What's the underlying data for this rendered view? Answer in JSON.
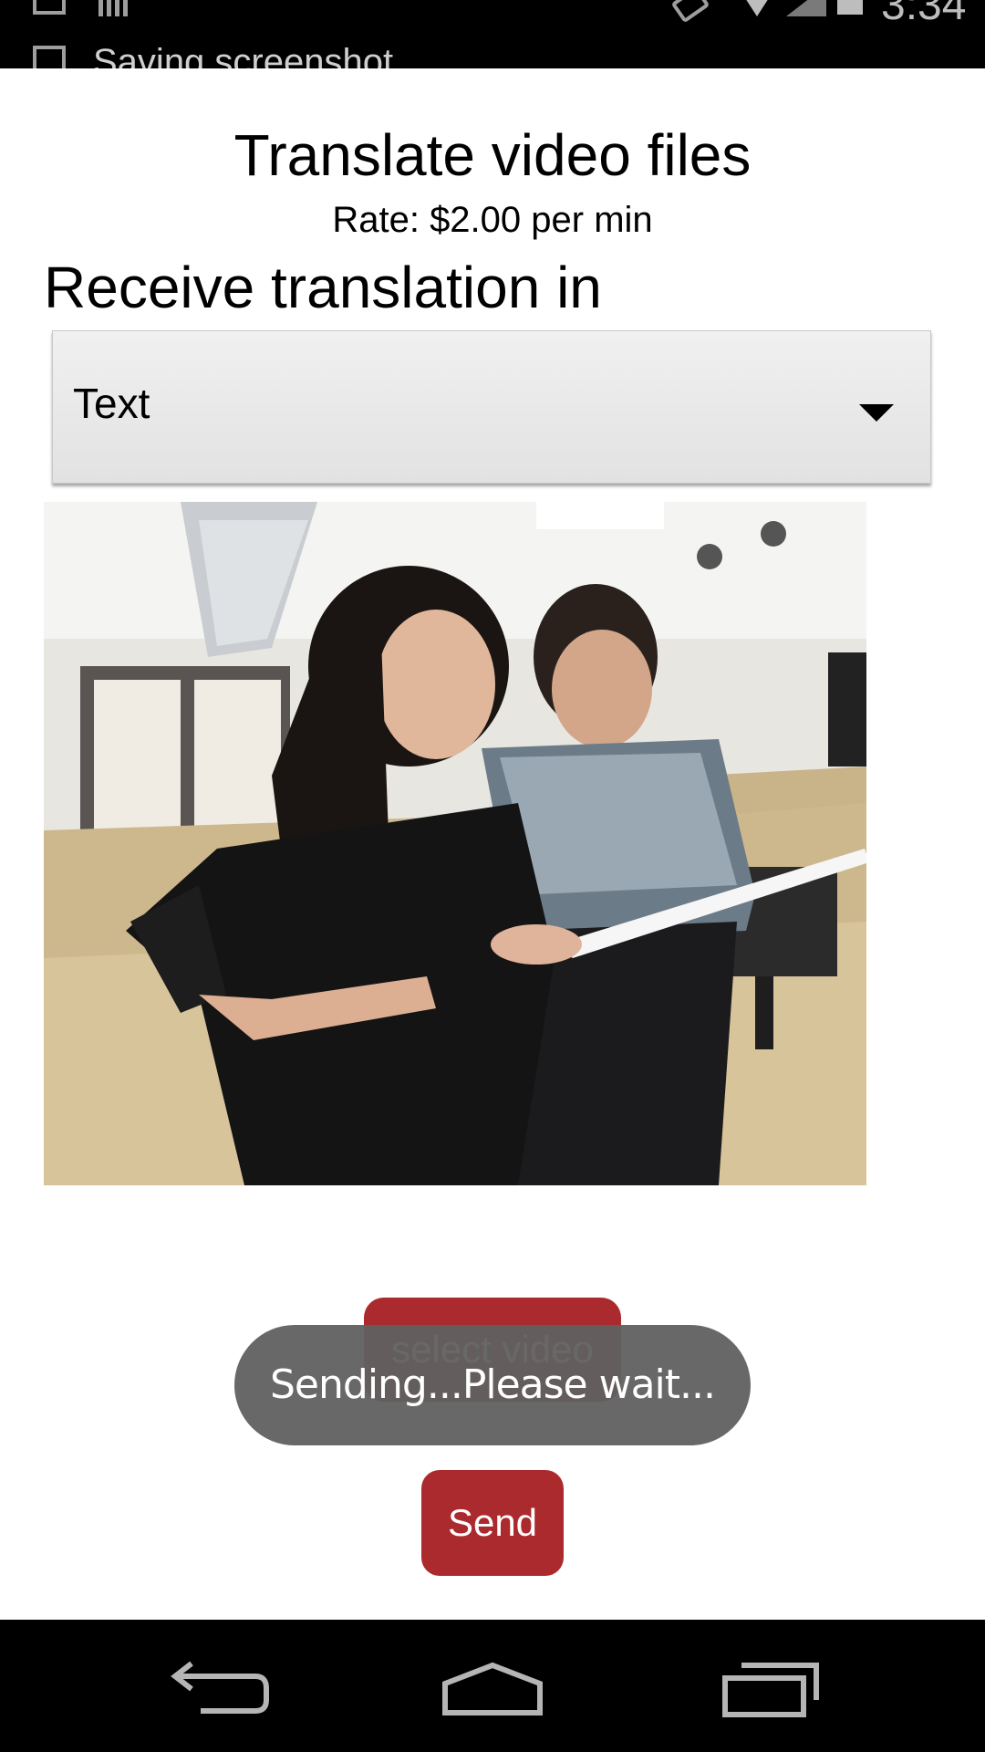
{
  "status_bar": {
    "notification_text": "Saving screenshot",
    "time": "3:34",
    "icons": [
      "gallery-icon",
      "sd-card-icon",
      "rotate-icon",
      "wifi-icon",
      "signal-icon",
      "battery-icon"
    ]
  },
  "header": {
    "title": "Translate video files",
    "rate": "Rate: $2.00 per min"
  },
  "translation": {
    "label": "Receive translation in",
    "selected": "Text"
  },
  "actions": {
    "select_video_label": "select video",
    "send_label": "Send"
  },
  "toast": {
    "message": "Sending...Please wait..."
  },
  "nav_bar": {
    "icons": [
      "back-icon",
      "home-icon",
      "recents-icon"
    ]
  },
  "colors": {
    "accent": "#ab2a2d",
    "toast_bg": "#606060",
    "bars": "#000000"
  }
}
